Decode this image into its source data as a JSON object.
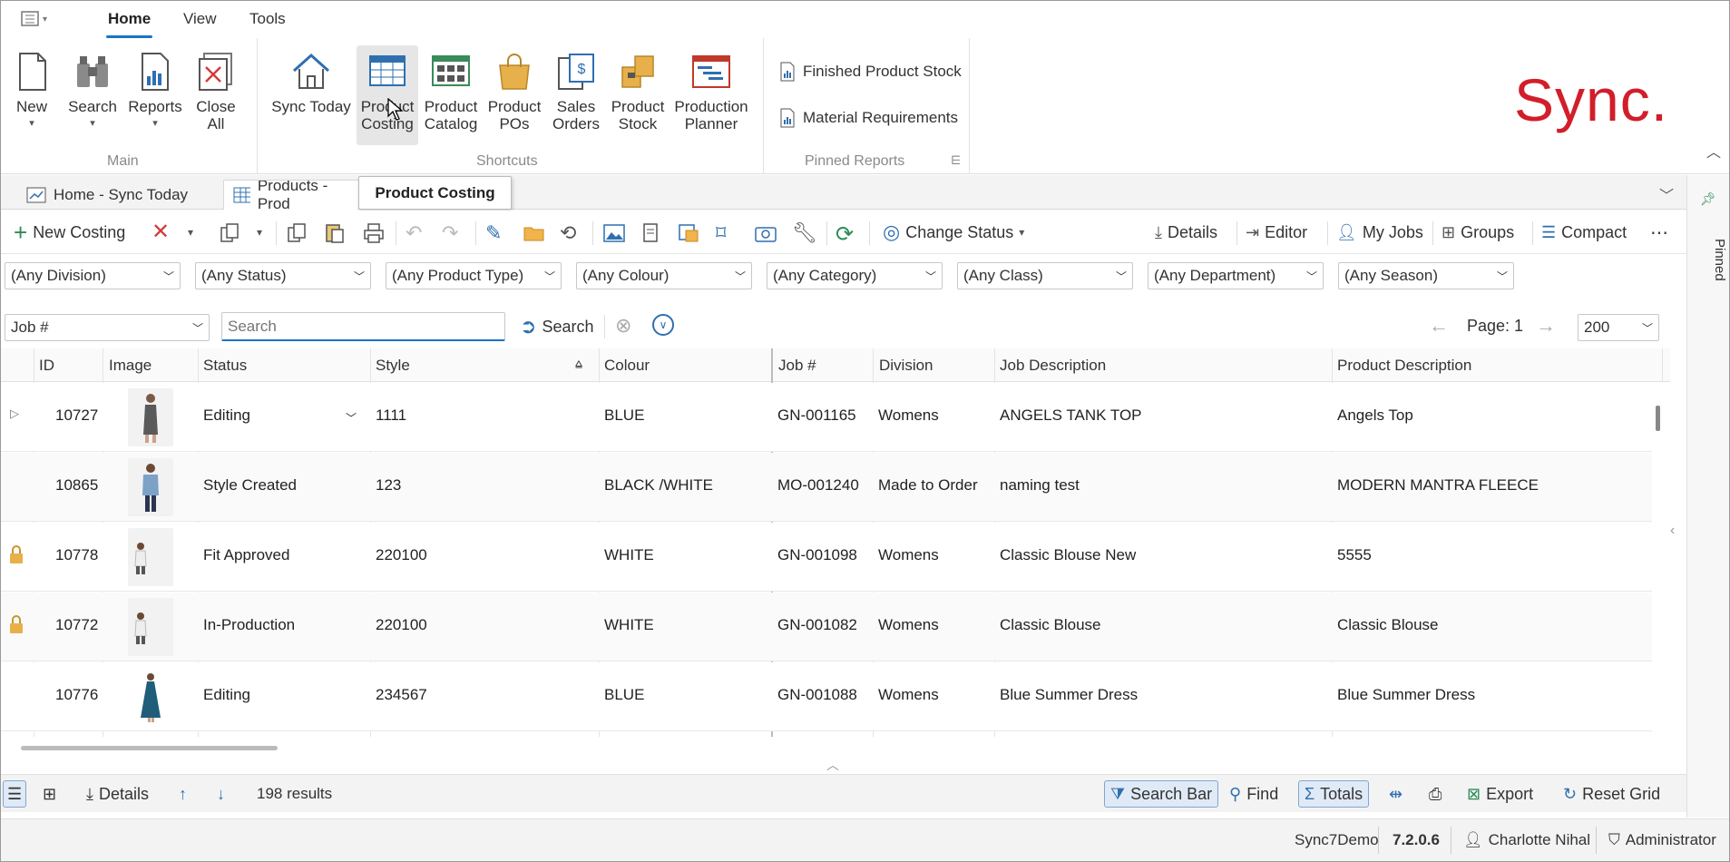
{
  "menu": {
    "tabs": [
      "Home",
      "View",
      "Tools"
    ]
  },
  "ribbon": {
    "main_group": "Main",
    "shortcuts_group": "Shortcuts",
    "pinned_group": "Pinned Reports",
    "main": [
      {
        "line1": "New",
        "line2": ""
      },
      {
        "line1": "Search",
        "line2": ""
      },
      {
        "line1": "Reports",
        "line2": ""
      },
      {
        "line1": "Close",
        "line2": "All"
      }
    ],
    "shortcuts": [
      {
        "line1": "Sync Today",
        "line2": ""
      },
      {
        "line1": "Product",
        "line2": "Costing"
      },
      {
        "line1": "Product",
        "line2": "Catalog"
      },
      {
        "line1": "Product",
        "line2": "POs"
      },
      {
        "line1": "Sales",
        "line2": "Orders"
      },
      {
        "line1": "Product",
        "line2": "Stock"
      },
      {
        "line1": "Production",
        "line2": "Planner"
      }
    ],
    "pinned": [
      "Finished Product Stock",
      "Material Requirements"
    ],
    "logo": "Sync."
  },
  "doc_tabs": [
    "Home - Sync Today",
    "Products - Prod"
  ],
  "tooltip": "Product Costing",
  "toolbar": {
    "new_costing": "New Costing",
    "change_status": "Change Status",
    "details": "Details",
    "editor": "Editor",
    "my_jobs": "My Jobs",
    "groups": "Groups",
    "compact": "Compact"
  },
  "filters": [
    "(Any Division)",
    "(Any Status)",
    "(Any Product Type)",
    "(Any Colour)",
    "(Any Category)",
    "(Any Class)",
    "(Any Department)",
    "(Any Season)"
  ],
  "search": {
    "field": "Job #",
    "placeholder": "Search",
    "button": "Search",
    "page": "Page: 1",
    "page_size": "200"
  },
  "grid": {
    "columns": [
      "ID",
      "Image",
      "Status",
      "Style",
      "Colour",
      "Job #",
      "Division",
      "Job Description",
      "Product Description"
    ],
    "rows": [
      {
        "id": "10727",
        "status": "Editing",
        "style": "1111",
        "colour": "BLUE",
        "job": "GN-001165",
        "division": "Womens",
        "job_desc": "ANGELS TANK TOP",
        "prod_desc": "Angels Top",
        "locked": false
      },
      {
        "id": "10865",
        "status": "Style Created",
        "style": "123",
        "colour": "BLACK /WHITE",
        "job": "MO-001240",
        "division": "Made to Order",
        "job_desc": "naming test",
        "prod_desc": "MODERN MANTRA FLEECE",
        "locked": false
      },
      {
        "id": "10778",
        "status": "Fit Approved",
        "style": "220100",
        "colour": "WHITE",
        "job": "GN-001098",
        "division": "Womens",
        "job_desc": "Classic Blouse New",
        "prod_desc": "5555",
        "locked": true
      },
      {
        "id": "10772",
        "status": "In-Production",
        "style": "220100",
        "colour": "WHITE",
        "job": "GN-001082",
        "division": "Womens",
        "job_desc": "Classic Blouse",
        "prod_desc": "Classic Blouse",
        "locked": true
      },
      {
        "id": "10776",
        "status": "Editing",
        "style": "234567",
        "colour": "BLUE",
        "job": "GN-001088",
        "division": "Womens",
        "job_desc": "Blue Summer Dress",
        "prod_desc": "Blue Summer Dress",
        "locked": false
      }
    ]
  },
  "bottom": {
    "details": "Details",
    "results": "198 results",
    "search_bar": "Search Bar",
    "find": "Find",
    "totals": "Totals",
    "export": "Export",
    "reset_grid": "Reset Grid"
  },
  "status": {
    "db": "Sync7Demo",
    "version": "7.2.0.6",
    "user": "Charlotte Nihal",
    "role": "Administrator"
  },
  "side_panel": "Pinned"
}
